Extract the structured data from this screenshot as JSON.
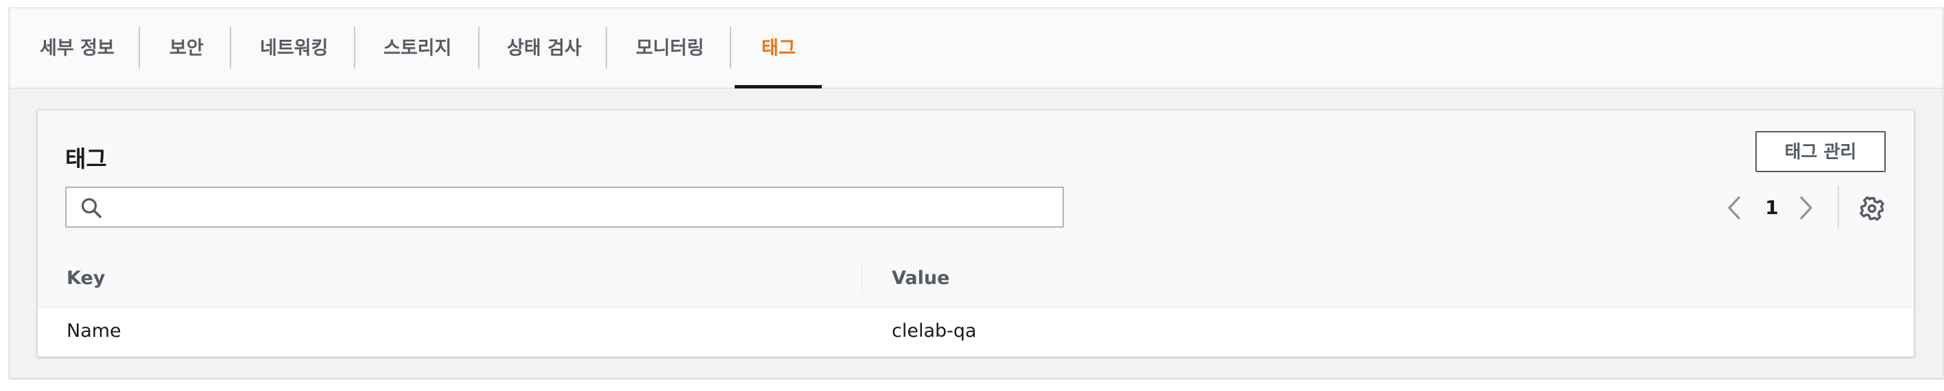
{
  "tabs": [
    {
      "label": "세부 정보",
      "active": false
    },
    {
      "label": "보안",
      "active": false
    },
    {
      "label": "네트워킹",
      "active": false
    },
    {
      "label": "스토리지",
      "active": false
    },
    {
      "label": "상태 검사",
      "active": false
    },
    {
      "label": "모니터링",
      "active": false
    },
    {
      "label": "태그",
      "active": true
    }
  ],
  "tags_panel": {
    "title": "태그",
    "manage_button": "태그 관리",
    "search": {
      "value": "",
      "placeholder": ""
    },
    "pagination": {
      "current_page": "1"
    },
    "columns": [
      "Key",
      "Value"
    ],
    "rows": [
      {
        "key": "Name",
        "value": "clelab-qa"
      }
    ]
  },
  "icons": {
    "search": "search-icon",
    "prev": "chevron-left-icon",
    "next": "chevron-right-icon",
    "settings": "gear-icon"
  },
  "colors": {
    "active_tab": "#ec7211",
    "text_primary": "#16191f",
    "text_secondary": "#545b64",
    "border": "#d5dbdb"
  }
}
